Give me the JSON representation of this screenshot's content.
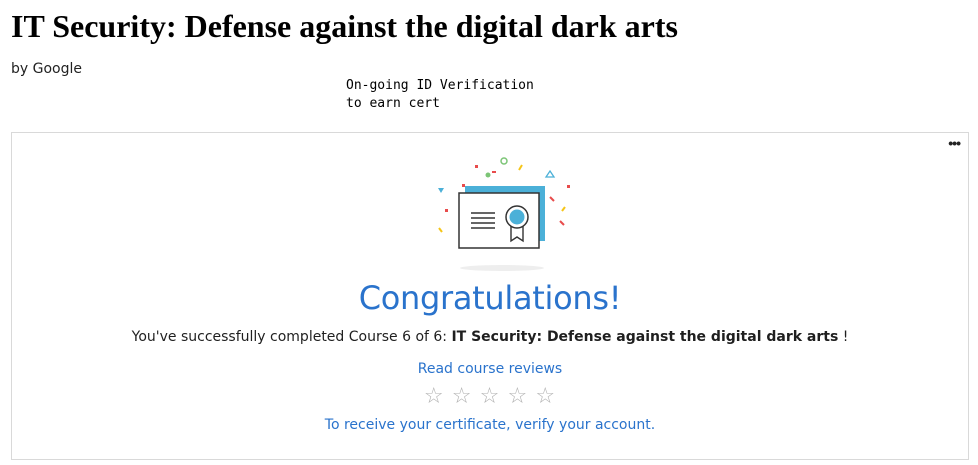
{
  "header": {
    "title": "IT Security: Defense against the digital dark arts",
    "byline": "by Google"
  },
  "id_verification_note": {
    "line1": "On-going ID Verification",
    "line2": "to earn cert"
  },
  "card": {
    "more_label": "•••",
    "illustration_icon": "certificate-icon",
    "congrats_title": "Congratulations!",
    "completion_prefix": "You've successfully completed Course 6 of 6: ",
    "course_name": "IT Security: Defense against the digital dark arts",
    "completion_suffix": " !",
    "reviews_link": "Read course reviews",
    "rating": {
      "filled": 0,
      "max": 5,
      "star_glyph": "☆"
    },
    "verify_link": "To receive your certificate, verify your account."
  },
  "colors": {
    "accent": "#2a73cc",
    "certificate_blue": "#4bb0d8",
    "star_empty": "#b3b3b3"
  }
}
